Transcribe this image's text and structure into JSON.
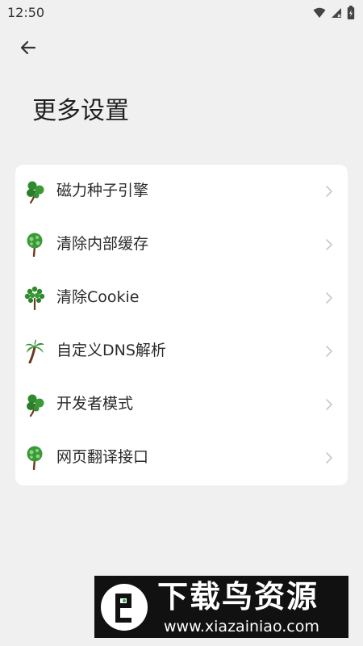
{
  "status_bar": {
    "time": "12:50",
    "icons": [
      "wifi-icon",
      "signal-icon",
      "battery-icon"
    ]
  },
  "header": {
    "back_icon": "arrow-left-icon",
    "title": "更多设置"
  },
  "settings": {
    "items": [
      {
        "label": "磁力种子引擎",
        "icon": "tree-clover-icon"
      },
      {
        "label": "清除内部缓存",
        "icon": "tree-round-icon"
      },
      {
        "label": "清除Cookie",
        "icon": "tree-dots-icon"
      },
      {
        "label": "自定义DNS解析",
        "icon": "palm-tree-icon"
      },
      {
        "label": "开发者模式",
        "icon": "tree-clover-icon"
      },
      {
        "label": "网页翻译接口",
        "icon": "tree-round-icon"
      }
    ]
  },
  "watermark": {
    "brand": "下载鸟资源",
    "url": "www.xiazainiao.com"
  },
  "colors": {
    "background": "#f0f0f0",
    "card": "#ffffff",
    "tree_green": "#2e8b2e",
    "trunk": "#6b3a1f"
  }
}
